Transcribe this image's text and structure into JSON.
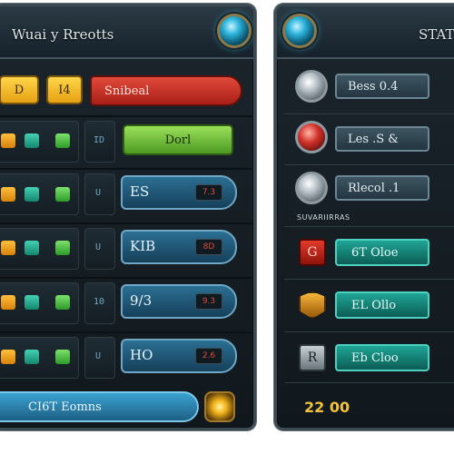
{
  "left_panel": {
    "title": "Wuai y Rreotts",
    "top_buttons": {
      "yellow_a": "D",
      "yellow_b": "I4",
      "red": "Snibeal",
      "green": "Dorl"
    },
    "rows": [
      {
        "code": "ID",
        "squares": [
          "",
          "",
          ""
        ],
        "bar_label": "",
        "bar_value": ""
      },
      {
        "code": "U",
        "squares": [
          "",
          "",
          ""
        ],
        "bar_label": "ES",
        "bar_value": "7.3"
      },
      {
        "code": "U",
        "squares": [
          "",
          "",
          ""
        ],
        "bar_label": "KIB",
        "bar_value": "8D"
      },
      {
        "code": "10",
        "squares": [
          "",
          "",
          ""
        ],
        "bar_label": "9/3",
        "bar_value": "9.3"
      },
      {
        "code": "U",
        "squares": [
          "",
          "",
          ""
        ],
        "bar_label": "HO",
        "bar_value": "2.6"
      }
    ],
    "bottom_button": "CI6T Eomns"
  },
  "right_panel": {
    "title": "STAT",
    "stats": [
      {
        "label": "Bess 0.4",
        "icon": "silver-shield-icon"
      },
      {
        "label": "Les .S &",
        "icon": "red-shield-icon"
      },
      {
        "label": "Rlecol .1",
        "icon": "silver-shield-icon"
      }
    ],
    "section_label": "SUVARIIRRAS",
    "items": [
      {
        "icon_text": "G",
        "label": "6T  Oloe",
        "icon": "red-box-icon"
      },
      {
        "icon_text": "",
        "label": "EL  Ollo",
        "icon": "gold-shield-icon"
      },
      {
        "icon_text": "R",
        "label": "Eb  Cloo",
        "icon": "grey-box-icon"
      }
    ],
    "footer": "22  00"
  }
}
